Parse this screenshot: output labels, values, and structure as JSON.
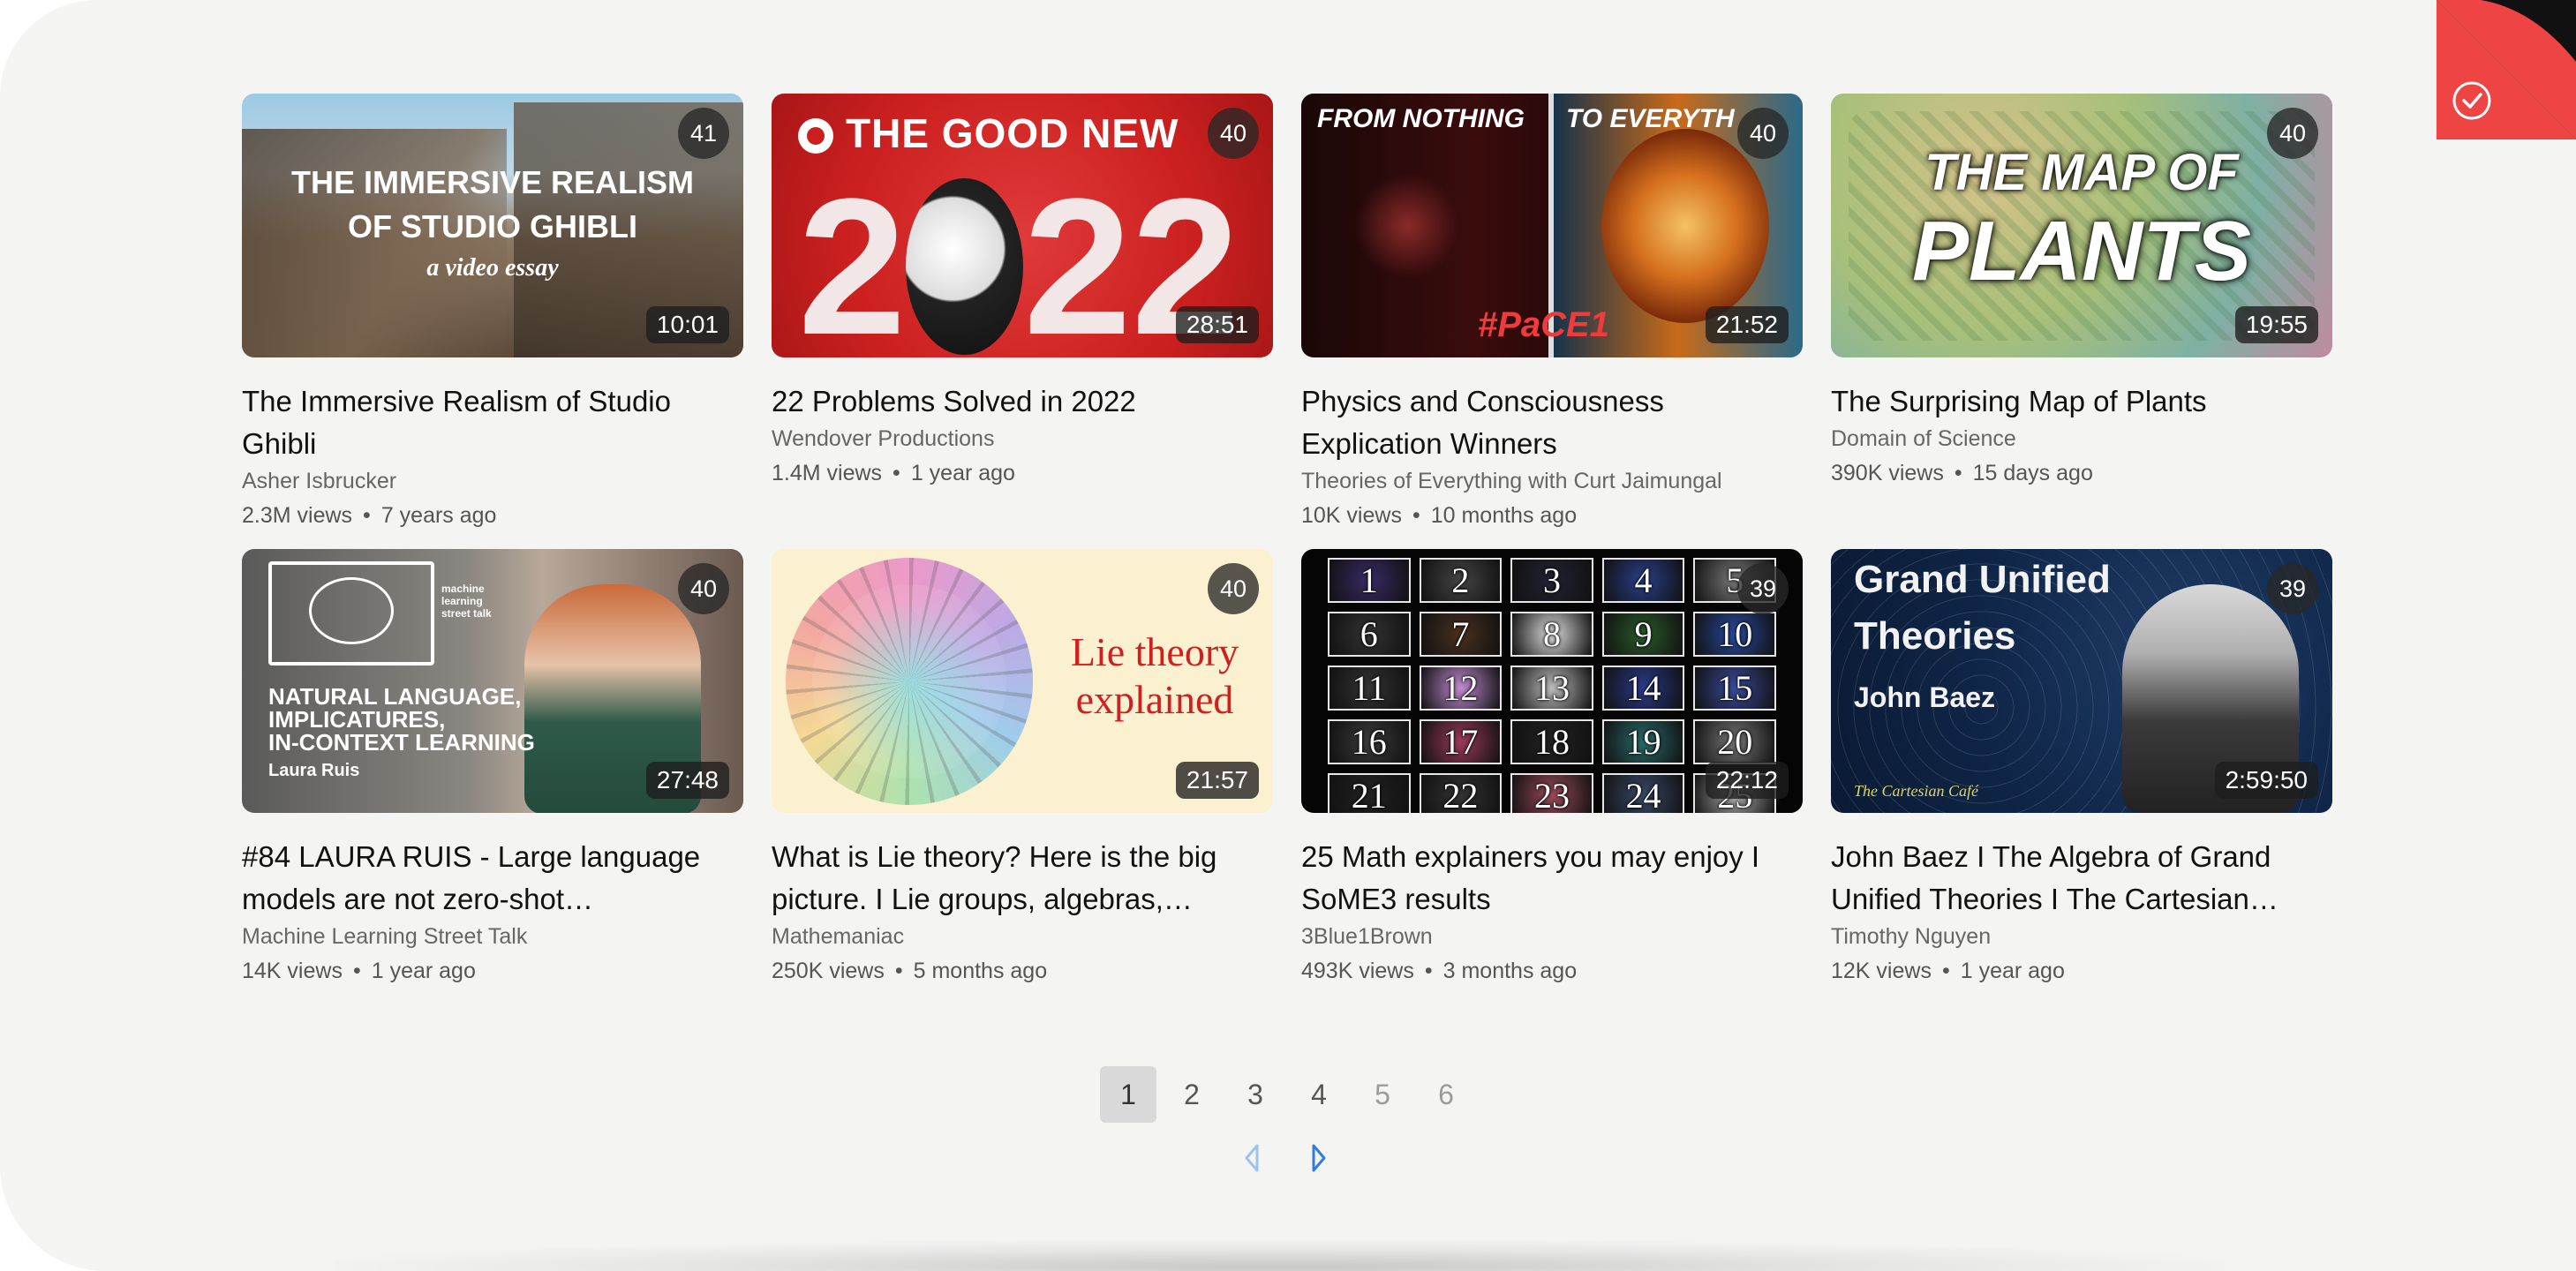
{
  "videos": [
    {
      "title": "The Immersive Realism of Studio Ghibli",
      "channel": "Asher Isbrucker",
      "views": "2.3M views",
      "age": "7 years ago",
      "duration": "10:01",
      "count": "41",
      "thumb_text": {
        "line1": "THE IMMERSIVE REALISM",
        "line2": "OF STUDIO GHIBLI",
        "line3": "a video essay"
      }
    },
    {
      "title": "22 Problems Solved in 2022",
      "channel": "Wendover Productions",
      "views": "1.4M views",
      "age": "1 year ago",
      "duration": "28:51",
      "count": "40",
      "thumb_text": {
        "line1": "THE GOOD NEW",
        "line2": "2022"
      }
    },
    {
      "title": "Physics and Consciousness Explication Winners",
      "channel": "Theories of Everything with Curt Jaimungal",
      "views": "10K views",
      "age": "10 months ago",
      "duration": "21:52",
      "count": "40",
      "thumb_text": {
        "line1": "FROM NOTHING",
        "line2": "TO EVERYTH",
        "line3": "#PaCE1"
      }
    },
    {
      "title": "The Surprising Map of Plants",
      "channel": "Domain of Science",
      "views": "390K views",
      "age": "15 days ago",
      "duration": "19:55",
      "count": "40",
      "thumb_text": {
        "line1": "THE MAP OF",
        "line2": "PLANTS"
      }
    },
    {
      "title": "#84 LAURA RUIS - Large language models are not zero-shot…",
      "channel": "Machine Learning Street Talk",
      "views": "14K views",
      "age": "1 year ago",
      "duration": "27:48",
      "count": "40",
      "thumb_text": {
        "line1": "NATURAL LANGUAGE,",
        "line2": "IMPLICATURES,",
        "line3": "IN-CONTEXT LEARNING",
        "line4": "Laura Ruis",
        "small": "machine learning street talk"
      }
    },
    {
      "title": "What is Lie theory? Here is the big picture. I Lie groups, algebras,…",
      "channel": "Mathemaniac",
      "views": "250K views",
      "age": "5 months ago",
      "duration": "21:57",
      "count": "40",
      "thumb_text": {
        "line1": "Lie theory",
        "line2": "explained"
      }
    },
    {
      "title": "25 Math explainers you may enjoy I SoME3 results",
      "channel": "3Blue1Brown",
      "views": "493K views",
      "age": "3 months ago",
      "duration": "22:12",
      "count": "39",
      "thumb_text": {
        "numbers": [
          "1",
          "2",
          "3",
          "4",
          "5",
          "6",
          "7",
          "8",
          "9",
          "10",
          "11",
          "12",
          "13",
          "14",
          "15",
          "16",
          "17",
          "18",
          "19",
          "20",
          "21",
          "22",
          "23",
          "24",
          "25"
        ]
      }
    },
    {
      "title": "John Baez I The Algebra of Grand Unified Theories I The Cartesian Cafe…",
      "channel": "Timothy Nguyen",
      "views": "12K views",
      "age": "1 year ago",
      "duration": "2:59:50",
      "count": "39",
      "thumb_text": {
        "line1": "Grand Unified",
        "line2": "Theories",
        "line3": "John Baez",
        "line4": "The Cartesian Café"
      }
    }
  ],
  "pagination": {
    "pages": [
      "1",
      "2",
      "3",
      "4",
      "5",
      "6"
    ],
    "active": "1"
  },
  "icons": {
    "corner": "check-icon",
    "prev": "caret-left-icon",
    "next": "caret-right-icon"
  },
  "colors": {
    "accent": "#ef4444",
    "corner_dark": "#111111",
    "background": "#f4f4f3",
    "arrow": "#2f7de1"
  }
}
